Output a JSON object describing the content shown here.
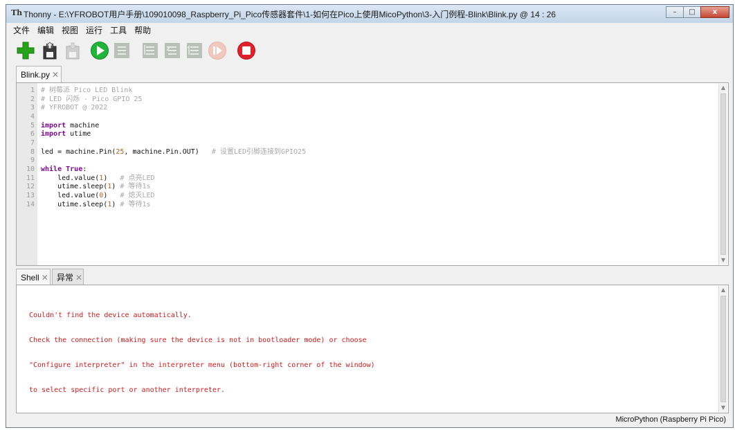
{
  "window": {
    "title": "Thonny  -  E:\\YFROBOT用户手册\\109010098_Raspberry_Pi_Pico传感器套件\\1-如何在Pico上使用MicoPython\\3-入门例程-Blink\\Blink.py  @  14 : 26",
    "app_icon": "Th",
    "controls": {
      "minimize": "–",
      "maximize": "□",
      "close": "x"
    }
  },
  "menu": [
    "文件",
    "编辑",
    "视图",
    "运行",
    "工具",
    "帮助"
  ],
  "toolbar": {
    "icons": [
      "new-file-icon",
      "open-file-icon",
      "save-file-icon",
      "run-icon",
      "debug-icon",
      "step-over-icon",
      "step-into-icon",
      "step-out-icon",
      "resume-icon",
      "stop-icon"
    ],
    "colors": {
      "new": "#27a21b",
      "run": "#20b43a",
      "stop": "#e0202a",
      "disabled": "#b8c0b8"
    }
  },
  "editor": {
    "tab_label": "Blink.py",
    "close_glyph": "✕",
    "line_numbers": [
      "1",
      "2",
      "3",
      "4",
      "5",
      "6",
      "7",
      "8",
      "9",
      "10",
      "11",
      "12",
      "13",
      "14"
    ],
    "code": [
      "# 树莓派 Pico LED Blink",
      "# LED 闪烁 - Pico GPIO 25",
      "# YFROBOT @ 2022",
      "",
      "import machine",
      "import utime",
      "",
      "led = machine.Pin(25, machine.Pin.OUT)   # 设置LED引脚连接到GPIO25",
      "",
      "while True:",
      "    led.value(1)   # 点亮LED",
      "    utime.sleep(1) # 等待1s",
      "    led.value(0)   # 熄灭LED",
      "    utime.sleep(1) # 等待1s"
    ]
  },
  "shell": {
    "tabs": [
      {
        "label": "Shell",
        "close_glyph": "✕"
      },
      {
        "label": "异常",
        "close_glyph": "✕"
      }
    ],
    "output": [
      "Couldn't find the device automatically.",
      "Check the connection (making sure the device is not in bootloader mode) or choose",
      "\"Configure interpreter\" in the interpreter menu (bottom-right corner of the window)",
      "to select specific port or another interpreter."
    ],
    "output_color": "#d01b1b"
  },
  "status": {
    "interpreter": "MicroPython (Raspberry Pi Pico)"
  }
}
